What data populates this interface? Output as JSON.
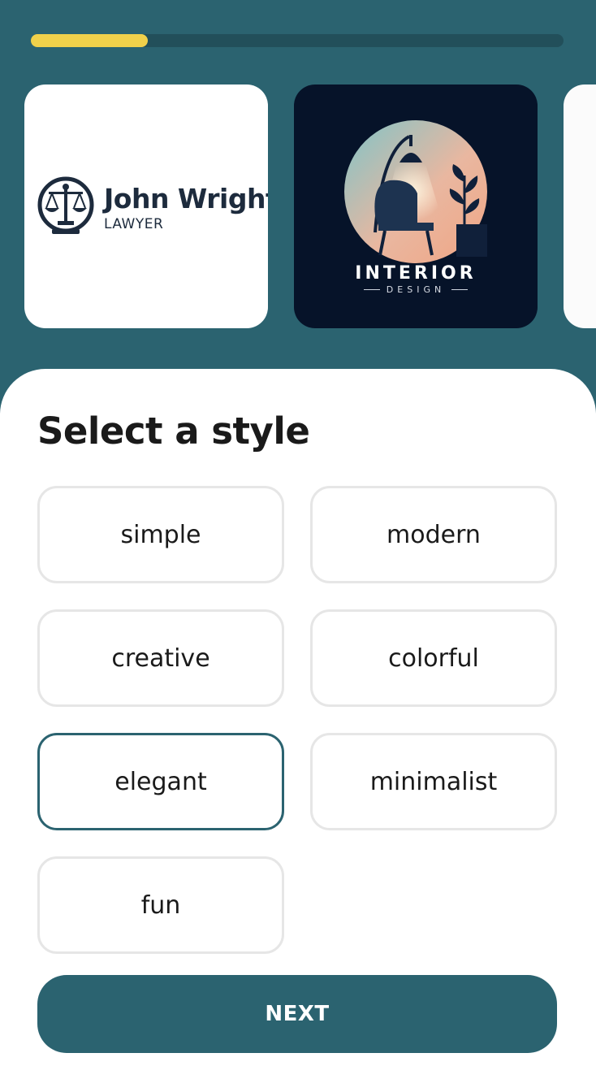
{
  "progress": {
    "fraction": 0.22
  },
  "colors": {
    "background": "#2b6370",
    "progress_fill": "#f0d14b",
    "accent": "#2b6370",
    "card_dark": "#061329"
  },
  "carousel": {
    "cards": [
      {
        "logo_name": "John Wright",
        "logo_sub": "LAWYER",
        "icon": "scales-of-justice-icon"
      },
      {
        "logo_name": "INTERIOR",
        "logo_sub": "DESIGN",
        "icon": "lamp-and-chair-icon"
      },
      {
        "logo_name": "",
        "logo_sub": ""
      }
    ]
  },
  "sheet": {
    "title": "Select a style",
    "options": [
      {
        "label": "simple",
        "selected": false
      },
      {
        "label": "modern",
        "selected": false
      },
      {
        "label": "creative",
        "selected": false
      },
      {
        "label": "colorful",
        "selected": false
      },
      {
        "label": "elegant",
        "selected": true
      },
      {
        "label": "minimalist",
        "selected": false
      },
      {
        "label": "fun",
        "selected": false
      }
    ],
    "next_label": "NEXT"
  }
}
